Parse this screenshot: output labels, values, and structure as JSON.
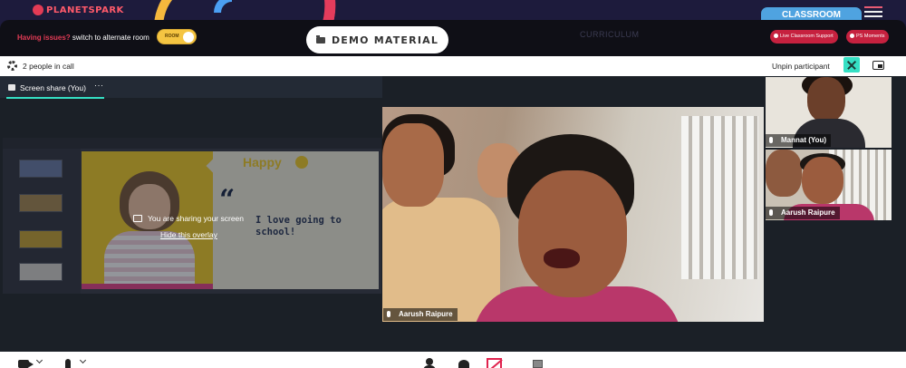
{
  "header": {
    "brand": "PLANETSPARK",
    "issues_text": "Having issues?",
    "alternate_room_text": "switch to alternate room",
    "toggle_label": "ROOM",
    "demo_material_label": "DEMO MATERIAL",
    "curriculum_label": "CURRICULUM",
    "classroom_tab_label": "CLASSROOM",
    "live_support_label": "Live Classroom Support",
    "ps_moments_label": "PS Moments",
    "colors": {
      "header_bg": "#1d1b3c",
      "accent_red": "#c6213f",
      "tab_blue": "#4fa3e0",
      "toggle_yellow": "#f5c542"
    }
  },
  "call": {
    "people_count_text": "2 people in call",
    "unpin_label": "Unpin participant",
    "unpin_color": "#35e0c4",
    "screen_share": {
      "tab_label": "Screen share (You)",
      "more_label": "···",
      "sharing_text": "You are sharing your screen",
      "hide_overlay_label": "Hide this overlay",
      "slide": {
        "heading": "Happy",
        "quote_mark": "“",
        "line1": "I love going to",
        "line2": "school!"
      }
    },
    "main_participant": {
      "name": "Aarush Raipure"
    },
    "thumbnails": [
      {
        "name": "Mannat (You)"
      },
      {
        "name": "Aarush Raipure"
      }
    ]
  },
  "controls": {
    "icons": [
      "camera-icon",
      "microphone-icon",
      "participants-icon",
      "chat-icon",
      "stop-share-icon",
      "more-options-icon"
    ]
  }
}
